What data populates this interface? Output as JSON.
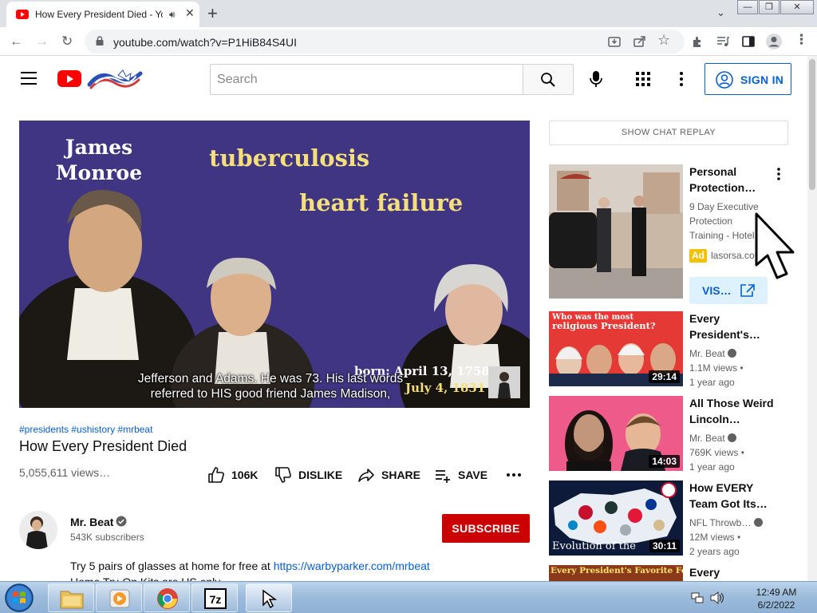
{
  "browser": {
    "tab_title": "How Every President Died - YouTube",
    "url": "youtube.com/watch?v=P1HiB84S4UI",
    "window_controls": [
      "—",
      "❐",
      "✕"
    ]
  },
  "youtube": {
    "search_placeholder": "Search",
    "sign_in": "SIGN IN"
  },
  "video": {
    "player": {
      "name_line1": "James",
      "name_line2": "Monroe",
      "cause1": "tuberculosis",
      "cause2": "heart failure",
      "born": "born: April 13, 1758",
      "died": "July 4, 1831",
      "caption_line1": "Jefferson and Adams. He was 73. His last words",
      "caption_line2": "referred to HIS good friend James Madison,"
    },
    "tags": "#presidents #ushistory #mrbeat",
    "title": "How Every President Died",
    "views": "5,055,611 views…",
    "actions": {
      "like": "106K",
      "dislike": "DISLIKE",
      "share": "SHARE",
      "save": "SAVE"
    },
    "channel": {
      "name": "Mr. Beat",
      "subscribers": "543K subscribers",
      "subscribe": "SUBSCRIBE"
    },
    "description": {
      "line1_text": "Try 5 pairs of glasses at home for free at ",
      "line1_link": "https://warbyparker.com/mrbeat",
      "line2": "Home Try-On Kits are US only"
    }
  },
  "sidebar": {
    "chat_replay": "SHOW CHAT REPLAY",
    "ad": {
      "title": "Personal Protection…",
      "desc_lines": [
        "9 Day Executive",
        "Protection",
        "Training - Hotel…"
      ],
      "badge": "Ad",
      "domain": "lasorsa.co…",
      "visit": "VIS…"
    },
    "items": [
      {
        "title": "Every President's…",
        "thumb_text1": "Who was the most",
        "thumb_text2": "religious President?",
        "channel": "Mr. Beat",
        "views": "1.1M views •",
        "age": "1 year ago",
        "duration": "29:14"
      },
      {
        "title": "All Those Weird Lincoln…",
        "channel": "Mr. Beat",
        "views": "769K views •",
        "age": "1 year ago",
        "duration": "14:03"
      },
      {
        "title": "How EVERY Team Got Its…",
        "thumb_text": "Evolution of the",
        "channel": "NFL Throwb…",
        "views": "12M views •",
        "age": "2 years ago",
        "duration": "30:11"
      },
      {
        "title": "Every",
        "thumb_text": "Every President's Favorite Food"
      }
    ]
  },
  "taskbar": {
    "time": "12:49 AM",
    "date": "6/2/2022"
  },
  "colors": {
    "yt_red": "#ff0000",
    "link_blue": "#065fd4",
    "subscribe_red": "#cc0000",
    "video_bg": "#3f3583",
    "video_yellow": "#f5df7a",
    "ad_yellow": "#f2c200"
  }
}
